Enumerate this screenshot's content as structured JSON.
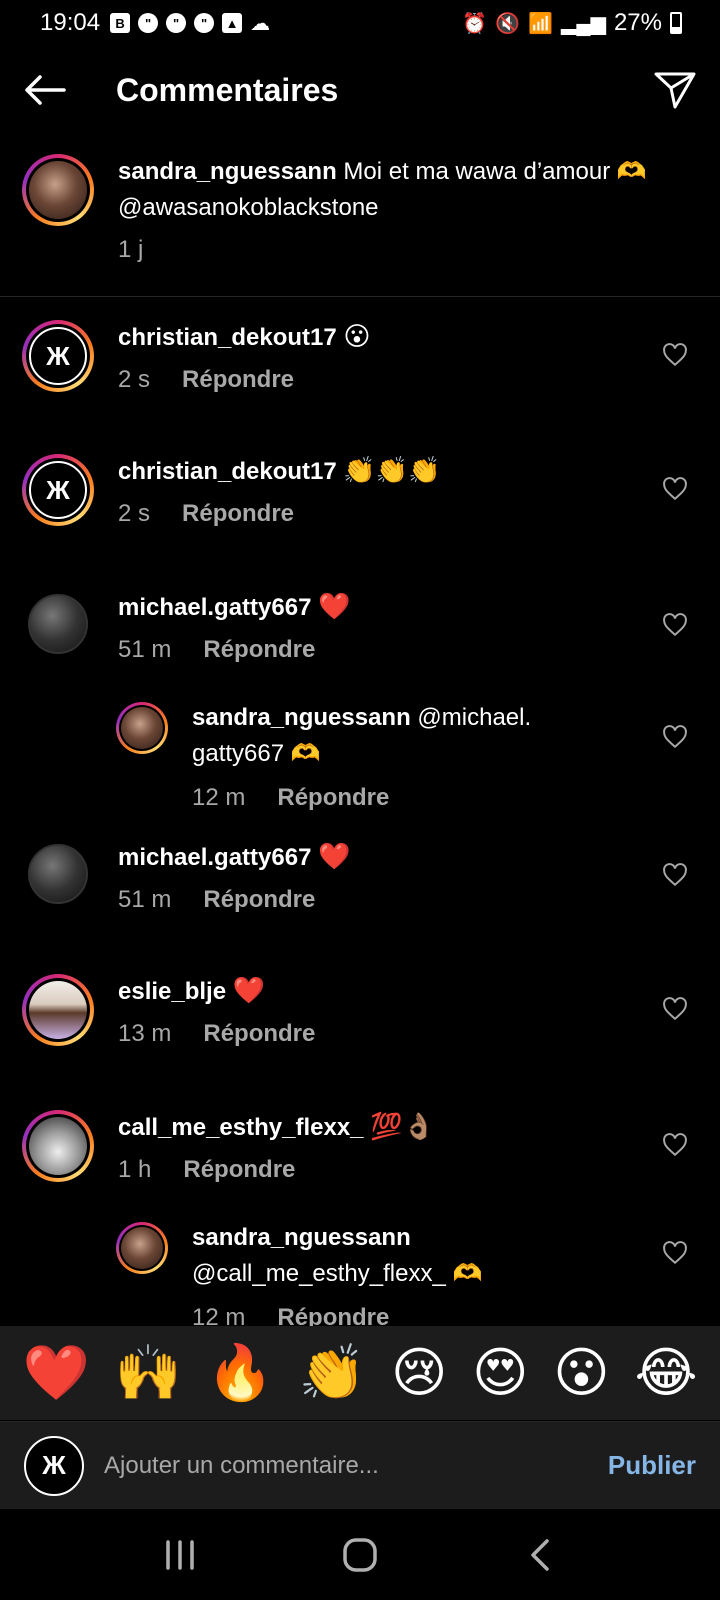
{
  "status": {
    "time": "19:04",
    "battery": "27%"
  },
  "header": {
    "title": "Commentaires"
  },
  "caption": {
    "username": "sandra_nguessann",
    "text": "Moi et ma wawa d’amour 🫶 @awasanokoblackstone",
    "time": "1 j"
  },
  "comments": [
    {
      "username": "christian_dekout17",
      "text": "😮",
      "time": "2 s",
      "reply": "Répondre"
    },
    {
      "username": "christian_dekout17",
      "text": "👏👏👏",
      "time": "2 s",
      "reply": "Répondre"
    },
    {
      "username": "michael.gatty667",
      "text": "❤️",
      "time": "51 m",
      "reply": "Répondre"
    },
    {
      "username": "sandra_nguessann",
      "text": "@michael. gatty667 🫶",
      "time": "12 m",
      "reply": "Répondre"
    },
    {
      "username": "michael.gatty667",
      "text": "❤️",
      "time": "51 m",
      "reply": "Répondre"
    },
    {
      "username": "eslie_blje",
      "text": "❤️",
      "time": "13 m",
      "reply": "Répondre"
    },
    {
      "username": "call_me_esthy_flexx_",
      "text": "💯👌🏽",
      "time": "1 h",
      "reply": "Répondre"
    },
    {
      "username": "sandra_nguessann",
      "text": "@call_me_esthy_flexx_ 🫶",
      "time": "12 m",
      "reply": "Répondre"
    }
  ],
  "emoji_bar": [
    "❤️",
    "🙌",
    "🔥",
    "👏",
    "😢",
    "😍",
    "😮",
    "😂"
  ],
  "composer": {
    "placeholder": "Ajouter un commentaire...",
    "publish": "Publier"
  },
  "colors": {
    "background": "#000000",
    "secondary_text": "#a8a8a8",
    "publish": "#85b6e6"
  }
}
